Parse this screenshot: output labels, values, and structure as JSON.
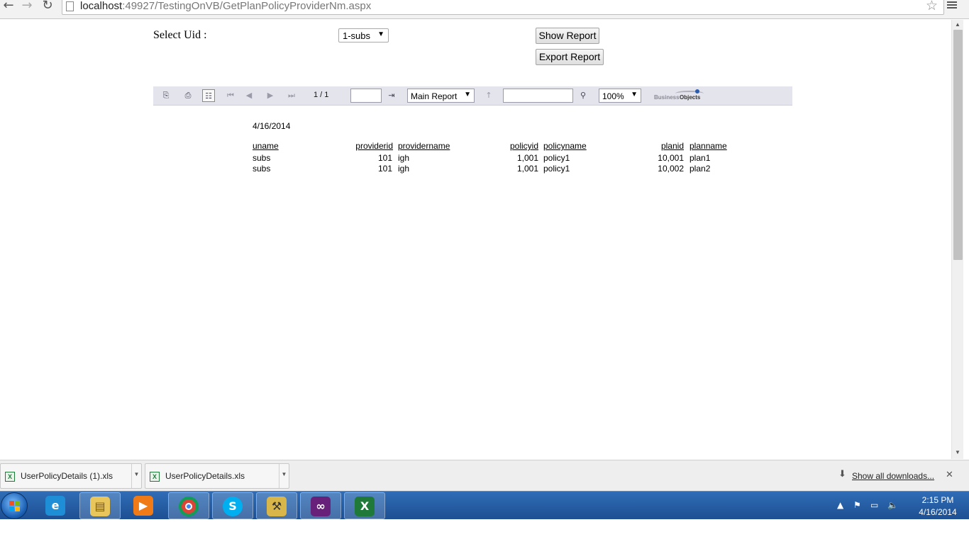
{
  "browser": {
    "url_host": "localhost",
    "url_rest": ":49927/TestingOnVB/GetPlanPolicyProviderNm.aspx"
  },
  "form": {
    "uid_label": "Select Uid :",
    "uid_selected": "1-subs",
    "show_report_label": "Show Report",
    "export_report_label": "Export Report"
  },
  "viewer": {
    "page_count": "1 / 1",
    "report_selected": "Main Report",
    "zoom_selected": "100%",
    "logo_word1": "Business",
    "logo_word2": "Objects"
  },
  "report": {
    "date": "4/16/2014",
    "columns": {
      "uname": "uname",
      "providerid": "providerid",
      "providername": "providername",
      "policyid": "policyid",
      "policyname": "policyname",
      "planid": "planid",
      "planname": "planname"
    },
    "rows": [
      {
        "uname": "subs",
        "providerid": "101",
        "providername": "igh",
        "policyid": "1,001",
        "policyname": "policy1",
        "planid": "10,001",
        "planname": "plan1"
      },
      {
        "uname": "subs",
        "providerid": "101",
        "providername": "igh",
        "policyid": "1,001",
        "policyname": "policy1",
        "planid": "10,002",
        "planname": "plan2"
      }
    ]
  },
  "downloads": {
    "items": [
      {
        "name": "UserPolicyDetails (1).xls"
      },
      {
        "name": "UserPolicyDetails.xls"
      }
    ],
    "show_all": "Show all downloads..."
  },
  "taskbar": {
    "time": "2:15 PM",
    "date": "4/16/2014"
  }
}
